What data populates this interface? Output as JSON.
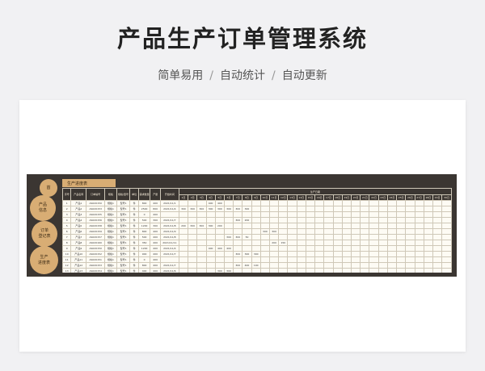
{
  "page": {
    "title": "产品生产订单管理系统",
    "subtitle": [
      "简单易用",
      "自动统计",
      "自动更新"
    ],
    "separator": "/"
  },
  "sheet": {
    "nav_buttons": [
      "首",
      "产品\n信息",
      "订单\n登记表",
      "生产\n进度表"
    ],
    "header_label": "生产进度表",
    "columns": [
      "序号",
      "产品名称",
      "订单编号",
      "规格",
      "规格/型号",
      "单位",
      "需求数量",
      "产量",
      "开始时间"
    ],
    "day_group_label": "生产日期",
    "day_columns": [
      "1日",
      "2日",
      "3日",
      "4日",
      "5日",
      "6日",
      "7日",
      "8日",
      "9日",
      "10日",
      "11日",
      "12日",
      "13日",
      "14日",
      "15日",
      "16日",
      "17日",
      "18日",
      "19日",
      "20日",
      "21日",
      "22日",
      "23日",
      "24日",
      "25日",
      "26日",
      "27日",
      "28日",
      "29日",
      "30日"
    ],
    "rows": [
      {
        "no": "1",
        "name": "产品1",
        "order": "AS020150",
        "spec": "规格1",
        "model": "型号1",
        "unit": "件",
        "demand": "800",
        "output": "400",
        "start": "2021/11/1",
        "days": {
          "4": "400",
          "5": "400"
        }
      },
      {
        "no": "2",
        "name": "产品2",
        "order": "AS020153",
        "spec": "规格1",
        "model": "型号1",
        "unit": "件",
        "demand": "2500",
        "output": "800",
        "start": "2021/11/4",
        "days": {
          "1": "300",
          "2": "300",
          "3": "300",
          "4": "300",
          "5": "300",
          "6": "300",
          "7": "300",
          "8": "300"
        }
      },
      {
        "no": "3",
        "name": "产品3",
        "order": "AS020155",
        "spec": "规格1",
        "model": "型号1",
        "unit": "件",
        "demand": "0",
        "output": "400",
        "start": "",
        "days": {}
      },
      {
        "no": "4",
        "name": "产品4",
        "order": "AS020156",
        "spec": "规格1",
        "model": "型号1",
        "unit": "件",
        "demand": "500",
        "output": "300",
        "start": "2021/11/7",
        "days": {
          "7": "300",
          "8": "200"
        }
      },
      {
        "no": "5",
        "name": "产品5",
        "order": "AS020158",
        "spec": "规格1",
        "model": "型号1",
        "unit": "件",
        "demand": "1200",
        "output": "300",
        "start": "2021/11/8",
        "days": {
          "1": "200",
          "2": "300",
          "3": "300",
          "4": "300",
          "5": "200"
        }
      },
      {
        "no": "6",
        "name": "产品6",
        "order": "AS020159",
        "spec": "规格1",
        "model": "型号1",
        "unit": "件",
        "demand": "800",
        "output": "400",
        "start": "2021/11/9",
        "days": {
          "10": "300",
          "11": "300"
        }
      },
      {
        "no": "7",
        "name": "产品7",
        "order": "AS020157",
        "spec": "规格1",
        "model": "型号1",
        "unit": "件",
        "demand": "500",
        "output": "400",
        "start": "2021/11/8",
        "days": {
          "6": "300",
          "7": "300",
          "8": "50"
        }
      },
      {
        "no": "8",
        "name": "产品8",
        "order": "AS020160",
        "spec": "规格1",
        "model": "型号1",
        "unit": "件",
        "demand": "350",
        "output": "400",
        "start": "2021/11/11",
        "days": {
          "11": "200",
          "12": "150"
        }
      },
      {
        "no": "9",
        "name": "产品9",
        "order": "AS020150",
        "spec": "规格1",
        "model": "型号1",
        "unit": "件",
        "demand": "1200",
        "output": "400",
        "start": "2021/11/4",
        "days": {
          "4": "400",
          "5": "400",
          "6": "400"
        }
      },
      {
        "no": "10",
        "name": "产品10",
        "order": "AS020152",
        "spec": "规格1",
        "model": "型号1",
        "unit": "件",
        "demand": "900",
        "output": "400",
        "start": "2021/11/7",
        "days": {
          "7": "300",
          "8": "300",
          "9": "300"
        }
      },
      {
        "no": "11",
        "name": "产品11",
        "order": "AS020151",
        "spec": "规格1",
        "model": "型号1",
        "unit": "件",
        "demand": "0",
        "output": "400",
        "start": "",
        "days": {}
      },
      {
        "no": "12",
        "name": "产品12",
        "order": "AS020153",
        "spec": "规格1",
        "model": "型号1",
        "unit": "件",
        "demand": "800",
        "output": "400",
        "start": "2021/11/7",
        "days": {
          "7": "300",
          "8": "400",
          "9": "100"
        }
      },
      {
        "no": "13",
        "name": "产品13",
        "order": "AS020154",
        "spec": "规格1",
        "model": "型号1",
        "unit": "件",
        "demand": "400",
        "output": "400",
        "start": "2021/11/6",
        "days": {
          "5": "300",
          "6": "300"
        }
      },
      {
        "no": "",
        "name": "",
        "order": "",
        "spec": "",
        "model": "",
        "unit": "",
        "demand": "",
        "output": "",
        "start": "",
        "days": {}
      },
      {
        "no": "",
        "name": "",
        "order": "",
        "spec": "",
        "model": "",
        "unit": "",
        "demand": "",
        "output": "",
        "start": "",
        "days": {}
      }
    ]
  },
  "colors": {
    "accent": "#d8ad74",
    "sheet_bg": "#3b3632",
    "grid_bg": "#fdfbf4"
  }
}
